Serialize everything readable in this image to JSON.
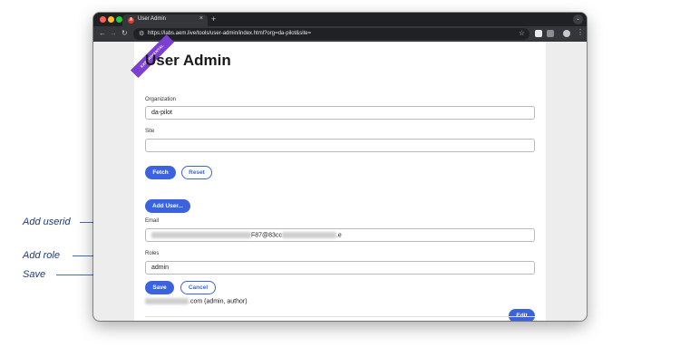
{
  "callouts": {
    "add_userid": "Add userid",
    "add_role": "Add role",
    "save": "Save"
  },
  "browser": {
    "tab_title": "User Admin",
    "tab_close": "×",
    "new_tab": "+",
    "url": "https://labs.aem.live/tools/user-admin/index.html?org=da-pilot&site=",
    "nav": {
      "back": "←",
      "forward": "→",
      "reload": "↻"
    },
    "star": "☆",
    "window_menu": "⌄"
  },
  "page": {
    "ribbon": "EXPERIMENTAL",
    "title": "User Admin",
    "organization": {
      "label": "Organization",
      "value": "da-pilot"
    },
    "site": {
      "label": "Site",
      "value": ""
    },
    "fetch_label": "Fetch",
    "reset_label": "Reset",
    "add_user_label": "Add User...",
    "email": {
      "label": "Email",
      "visible_fragment": "F87@83cc",
      "suffix": ".e"
    },
    "roles": {
      "label": "Roles",
      "value": "admin"
    },
    "save_label": "Save",
    "cancel_label": "Cancel",
    "user_entry": {
      "suffix": ".com (admin, author)"
    },
    "edit_label": "Edit"
  },
  "colors": {
    "accent": "#3b63e0",
    "ribbon": "#7b3fd1",
    "callout_text": "#1e3a78"
  }
}
